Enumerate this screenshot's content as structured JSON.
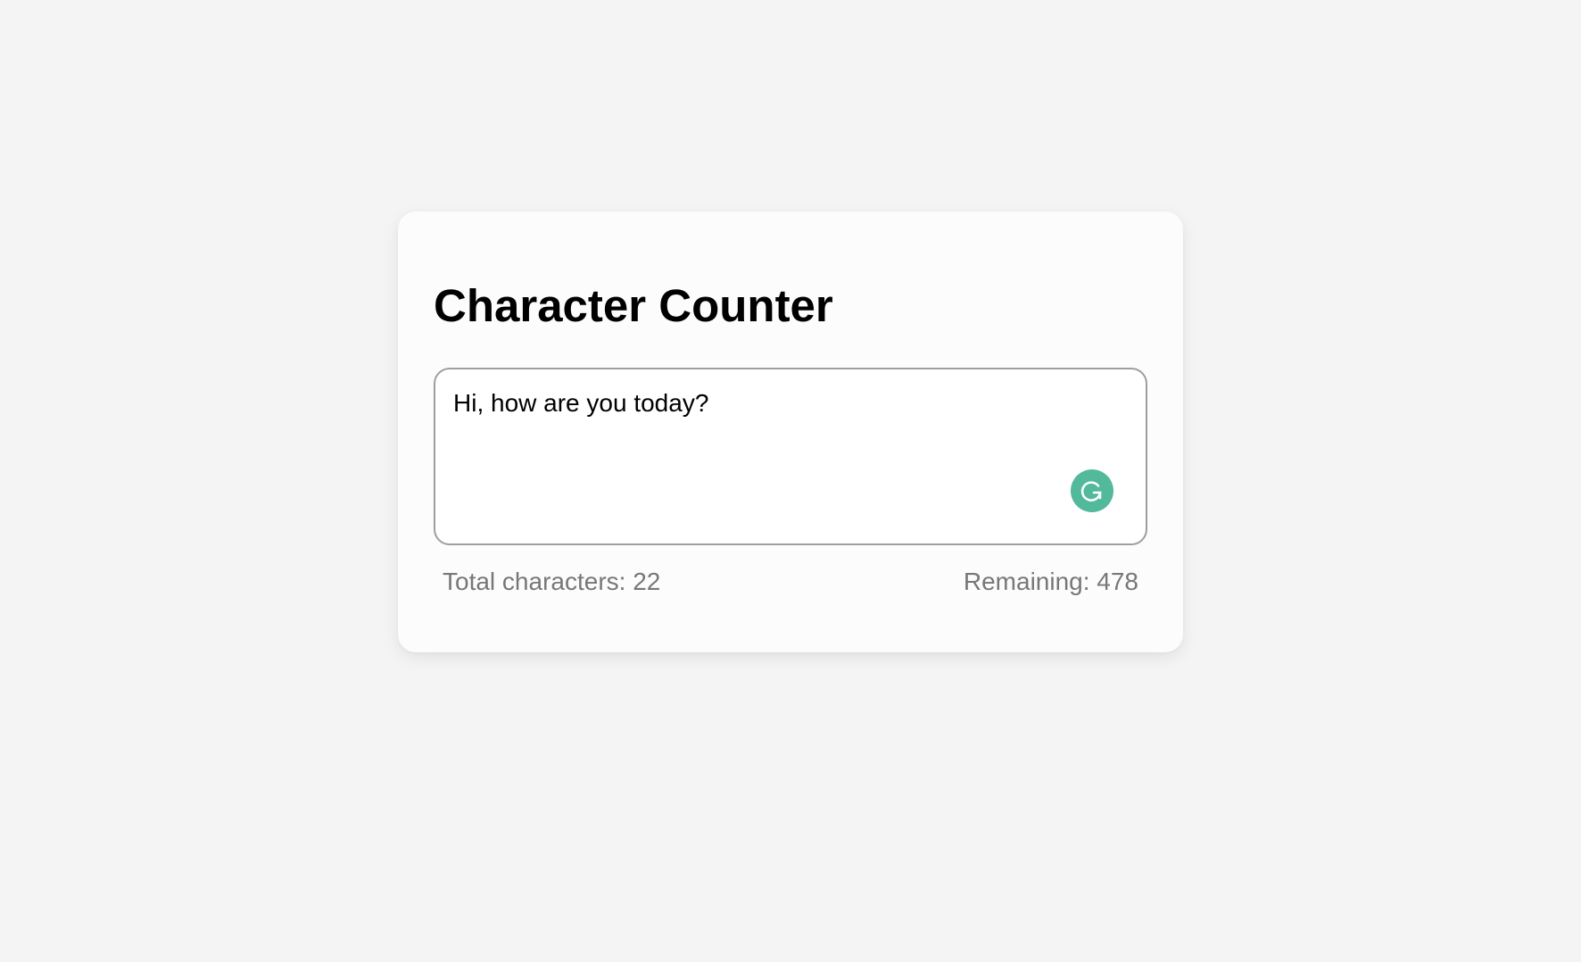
{
  "page": {
    "title": "Character Counter"
  },
  "editor": {
    "value": "Hi, how are you today?",
    "assist_icon": "grammarly-icon",
    "assist_color": "#52b99a"
  },
  "stats": {
    "total_label": "Total characters: 22",
    "remaining_label": "Remaining: 478"
  }
}
